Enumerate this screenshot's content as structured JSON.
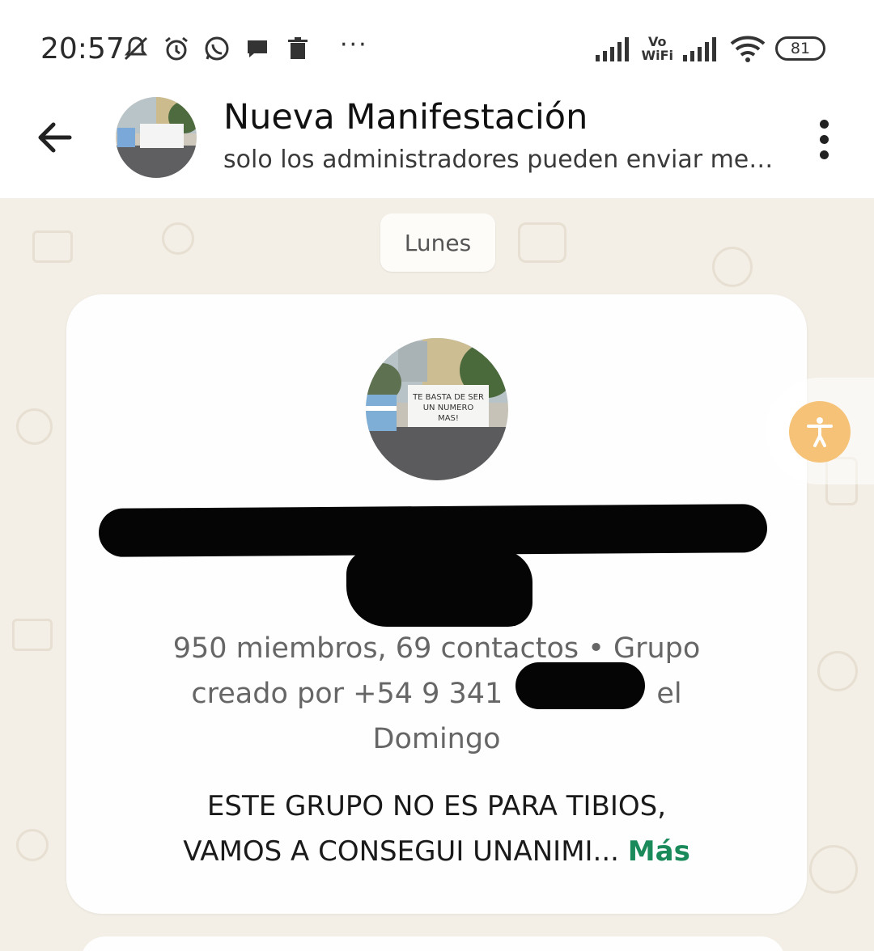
{
  "status_bar": {
    "time": "20:57",
    "overflow": "···",
    "vowifi_top": "Vo",
    "vowifi_bottom": "WiFi",
    "battery": "81",
    "icons": [
      "mute-bell-icon",
      "alarm-icon",
      "whatsapp-icon",
      "chat-bubble-icon",
      "trash-icon",
      "signal-icon",
      "signal-icon",
      "wifi-icon",
      "battery-icon"
    ]
  },
  "header": {
    "title": "Nueva Manifestación",
    "subtitle": "solo los administradores pueden enviar me…",
    "back_icon": "back-arrow-icon",
    "menu_icon": "more-vert-icon"
  },
  "chat": {
    "date_chip": "Lunes",
    "group_info": {
      "meta_line1": "950 miembros, 69 contactos • Grupo",
      "meta_line2_prefix": "creado por +54 9 341",
      "meta_line2_suffix": "el",
      "meta_line3": "Domingo",
      "description_line1": "ESTE GRUPO NO ES PARA TIBIOS,",
      "description_line2": "VAMOS A CONSEGUI UNANIMI...",
      "more_label": "Más",
      "banner_text": [
        "TE BASTA DE SER",
        "UN NUMERO",
        "MAS!"
      ]
    }
  },
  "colors": {
    "accent_green": "#1a8a5a",
    "chat_background": "#f3efe6",
    "accessibility_button": "#f5c277"
  }
}
